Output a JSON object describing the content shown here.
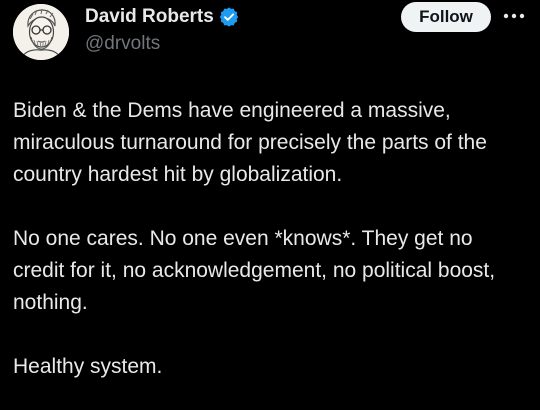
{
  "author": {
    "display_name": "David Roberts",
    "handle": "@drvolts"
  },
  "actions": {
    "follow_label": "Follow"
  },
  "tweet": {
    "paragraphs": [
      "Biden & the Dems have engineered a massive, miraculous turnaround for precisely the parts of the country hardest hit by globalization.",
      "No one cares. No one even *knows*. They get no credit for it, no acknowledgement, no political boost, nothing.",
      "Healthy system."
    ]
  },
  "icons": {
    "avatar": "avatar-illustration",
    "verified": "verified-badge-icon",
    "more": "more-options-icon"
  },
  "colors": {
    "background": "#000000",
    "text_primary": "#e7e9ea",
    "text_secondary": "#71767b",
    "verified_blue": "#1d9bf0",
    "follow_bg": "#eff3f4",
    "follow_text": "#0f1419"
  }
}
